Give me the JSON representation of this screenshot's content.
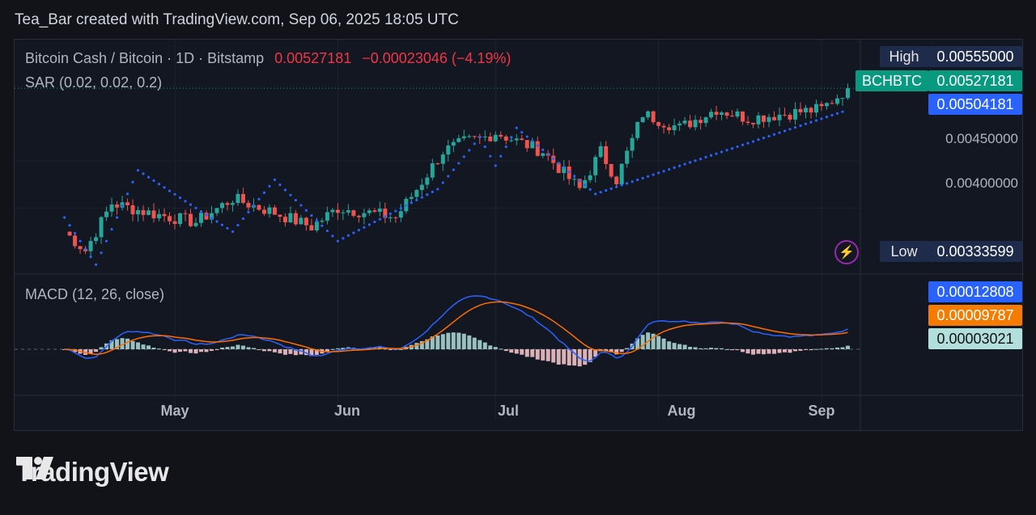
{
  "caption": "Tea_Bar created with TradingView.com, Sep 06, 2025 18:05 UTC",
  "legend": {
    "symbol": "Bitcoin Cash / Bitcoin · 1D · Bitstamp",
    "price": "0.00527181",
    "change": "−0.00023046 (−4.19%)",
    "sar": "SAR (0.02, 0.02, 0.2)",
    "macd": "MACD (12, 26, close)"
  },
  "price_axis": {
    "ticks": [
      "0.00450000",
      "0.00400000"
    ],
    "high": {
      "label": "High",
      "value": "0.00555000"
    },
    "last": {
      "label": "BCHBTC",
      "value": "0.00527181"
    },
    "sar_value": "0.00504181",
    "low": {
      "label": "Low",
      "value": "0.00333599"
    }
  },
  "macd_axis": {
    "macd_value": "0.00012808",
    "signal_value": "0.00009787",
    "hist_value": "0.00003021"
  },
  "x_axis": [
    "May",
    "Jun",
    "Jul",
    "Aug",
    "Sep"
  ],
  "colors": {
    "up": "#26a69a",
    "down": "#ef5350",
    "sar": "#2962ff",
    "macd": "#2962ff",
    "signal": "#ff6d00",
    "hist_up": "#b2dfdb",
    "hist_down": "#ffcdd2",
    "tag_green": "#089981",
    "tag_blue": "#2962ff",
    "tag_orange": "#f57c00"
  },
  "brand": "TradingView",
  "chart_data": {
    "type": "candlestick",
    "title": "Bitcoin Cash / Bitcoin · 1D · Bitstamp",
    "x_labels": [
      "May",
      "Jun",
      "Jul",
      "Aug",
      "Sep"
    ],
    "ylim": [
      0.0033,
      0.0057
    ],
    "anchors": [
      {
        "date": "2025-04-10",
        "close": 0.00375
      },
      {
        "date": "2025-04-14",
        "close": 0.00355
      },
      {
        "date": "2025-04-19",
        "close": 0.00405
      },
      {
        "date": "2025-04-26",
        "close": 0.00395
      },
      {
        "date": "2025-05-05",
        "close": 0.00385
      },
      {
        "date": "2025-05-12",
        "close": 0.0041
      },
      {
        "date": "2025-05-20",
        "close": 0.00395
      },
      {
        "date": "2025-05-27",
        "close": 0.0038
      },
      {
        "date": "2025-06-01",
        "close": 0.004
      },
      {
        "date": "2025-06-07",
        "close": 0.00395
      },
      {
        "date": "2025-06-12",
        "close": 0.0039
      },
      {
        "date": "2025-06-16",
        "close": 0.0042
      },
      {
        "date": "2025-06-21",
        "close": 0.0046
      },
      {
        "date": "2025-06-25",
        "close": 0.0047
      },
      {
        "date": "2025-06-29",
        "close": 0.00475
      },
      {
        "date": "2025-07-01",
        "close": 0.0048
      },
      {
        "date": "2025-07-10",
        "close": 0.0046
      },
      {
        "date": "2025-07-17",
        "close": 0.0042
      },
      {
        "date": "2025-07-21",
        "close": 0.0046
      },
      {
        "date": "2025-07-24",
        "close": 0.0043
      },
      {
        "date": "2025-07-29",
        "close": 0.005
      },
      {
        "date": "2025-08-05",
        "close": 0.00485
      },
      {
        "date": "2025-08-12",
        "close": 0.00505
      },
      {
        "date": "2025-08-18",
        "close": 0.00495
      },
      {
        "date": "2025-08-25",
        "close": 0.005
      },
      {
        "date": "2025-09-01",
        "close": 0.00505
      },
      {
        "date": "2025-09-06",
        "close": 0.00527
      }
    ],
    "sar_levels": [
      {
        "date": "2025-04-10",
        "value": 0.0039
      },
      {
        "date": "2025-04-16",
        "value": 0.0034
      },
      {
        "date": "2025-04-24",
        "value": 0.0044
      },
      {
        "date": "2025-05-05",
        "value": 0.004
      },
      {
        "date": "2025-05-12",
        "value": 0.00375
      },
      {
        "date": "2025-05-20",
        "value": 0.0043
      },
      {
        "date": "2025-06-01",
        "value": 0.00365
      },
      {
        "date": "2025-06-20",
        "value": 0.0042
      },
      {
        "date": "2025-06-28",
        "value": 0.00475
      },
      {
        "date": "2025-07-01",
        "value": 0.00445
      },
      {
        "date": "2025-07-05",
        "value": 0.00485
      },
      {
        "date": "2025-07-20",
        "value": 0.00415
      },
      {
        "date": "2025-09-06",
        "value": 0.00504
      }
    ],
    "macd": {
      "macd_last": 0.00012808,
      "signal_last": 9.787e-05,
      "histogram_last": 3.021e-05
    }
  }
}
